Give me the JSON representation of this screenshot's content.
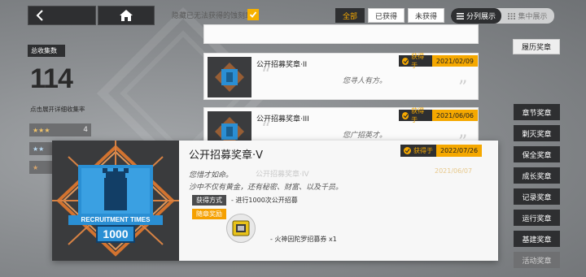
{
  "topbar": {
    "back_icon": "back-arrow-icon",
    "home_icon": "home-icon",
    "hide_unobtainable_label": "隐藏已无法获得的蚀刻章",
    "hide_unobtainable_checked": true,
    "filters": [
      "全部",
      "已获得",
      "未获得"
    ],
    "active_filter": "全部",
    "view_split_label": "分列展示",
    "view_concentrate_label": "集中展示"
  },
  "summary": {
    "total_label": "总收集数",
    "total_value": "114",
    "hint": "点击展开详细收集率",
    "rarity": [
      {
        "stars": "★★★",
        "count": "4"
      },
      {
        "stars": "★★",
        "count": ""
      },
      {
        "stars": "★",
        "count": ""
      }
    ]
  },
  "list": [
    {
      "title": "公开招募奖章·II",
      "quote": "您寻人有方。",
      "obtained_label": "获得于",
      "date": "2021/02/09"
    },
    {
      "title": "公开招募奖章·III",
      "quote": "您广招英才。",
      "obtained_label": "获得于",
      "date": "2021/06/06"
    }
  ],
  "detail": {
    "title": "公开招募奖章·V",
    "obtained_label": "获得于",
    "date": "2022/07/26",
    "desc_line1": "您惜才如命。",
    "desc_line2": "沙中不仅有黄金，还有秘密、财富、以及千员。",
    "method_label": "获得方式",
    "method_text": "- 进行1000次公开招募",
    "reward_label": "随章奖励",
    "reward_text": "- 火神因陀罗招募券 x1",
    "badge_text_1": "RECRUITMENT TIMES",
    "badge_text_2": "1000",
    "ghost_title": "公开招募奖章·IV",
    "ghost_date": "2021/06/07"
  },
  "nav": {
    "history": "履历奖章",
    "categories": [
      {
        "label": "章节奖章",
        "dim": false
      },
      {
        "label": "剿灭奖章",
        "dim": false
      },
      {
        "label": "保全奖章",
        "dim": false
      },
      {
        "label": "成长奖章",
        "dim": false
      },
      {
        "label": "记录奖章",
        "dim": false
      },
      {
        "label": "运行奖章",
        "dim": false
      },
      {
        "label": "基建奖章",
        "dim": false
      },
      {
        "label": "活动奖章",
        "dim": true
      }
    ]
  },
  "colors": {
    "accent": "#f5a800",
    "dark": "#2e2f31",
    "badge_blue": "#2a8fd4",
    "badge_orange": "#e47a2e"
  }
}
